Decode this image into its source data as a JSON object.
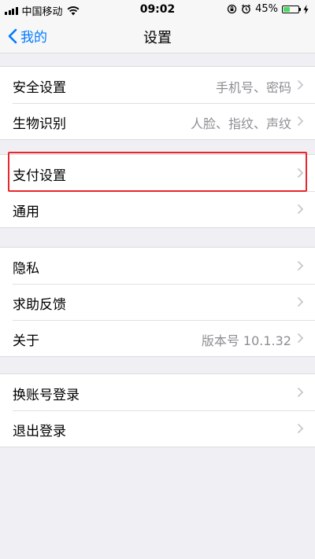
{
  "status_bar": {
    "carrier": "中国移动",
    "time": "09:02",
    "battery_percent_label": "45%",
    "battery_level": 0.45,
    "icons": [
      "signal-icon",
      "wifi-icon",
      "rotation-lock-icon",
      "alarm-icon",
      "battery-icon",
      "charging-icon"
    ]
  },
  "nav": {
    "back_label": "我的",
    "title": "设置"
  },
  "groups": [
    {
      "rows": [
        {
          "label": "安全设置",
          "value": "手机号、密码"
        },
        {
          "label": "生物识别",
          "value": "人脸、指纹、声纹"
        }
      ]
    },
    {
      "rows": [
        {
          "label": "支付设置",
          "value": ""
        },
        {
          "label": "通用",
          "value": ""
        }
      ]
    },
    {
      "rows": [
        {
          "label": "隐私",
          "value": ""
        },
        {
          "label": "求助反馈",
          "value": ""
        },
        {
          "label": "关于",
          "value": "版本号 10.1.32"
        }
      ]
    },
    {
      "rows": [
        {
          "label": "换账号登录",
          "value": ""
        },
        {
          "label": "退出登录",
          "value": ""
        }
      ]
    }
  ],
  "colors": {
    "accent": "#007aff",
    "background": "#efeff4",
    "highlight": "#e8262b",
    "battery": "#4cd964"
  }
}
